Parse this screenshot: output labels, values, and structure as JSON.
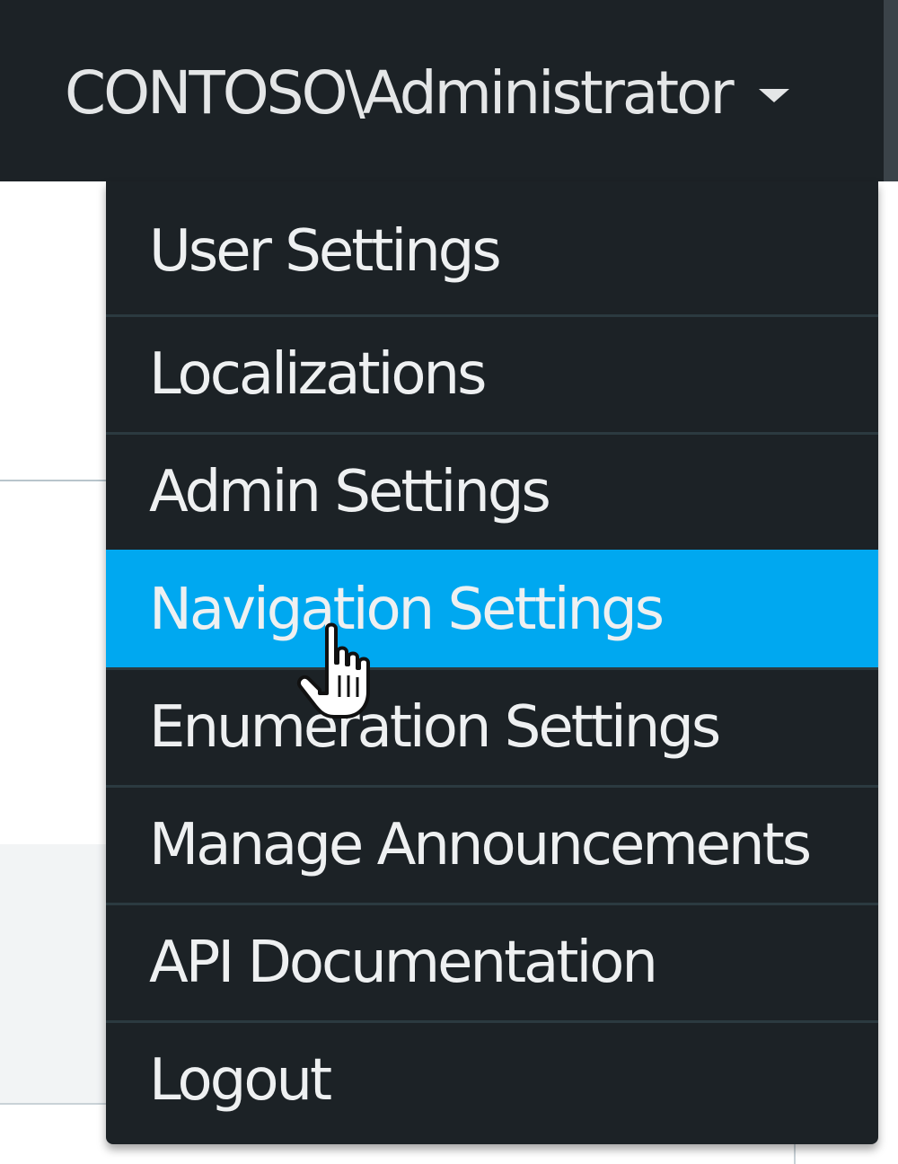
{
  "header": {
    "user_label": "CONTOSO\\Administrator"
  },
  "user_menu": {
    "items": [
      {
        "label": "User Settings"
      },
      {
        "label": "Localizations"
      },
      {
        "label": "Admin Settings"
      },
      {
        "label": "Navigation Settings",
        "highlighted": true
      },
      {
        "label": "Enumeration Settings"
      },
      {
        "label": "Manage Announcements"
      },
      {
        "label": "API Documentation"
      },
      {
        "label": "Logout"
      }
    ]
  },
  "colors": {
    "nav_background": "#1c2226",
    "highlight": "#00a8f0",
    "text": "#eef0f1",
    "divider": "#2b3a40"
  },
  "cursor_icon": "hand-pointer-icon"
}
